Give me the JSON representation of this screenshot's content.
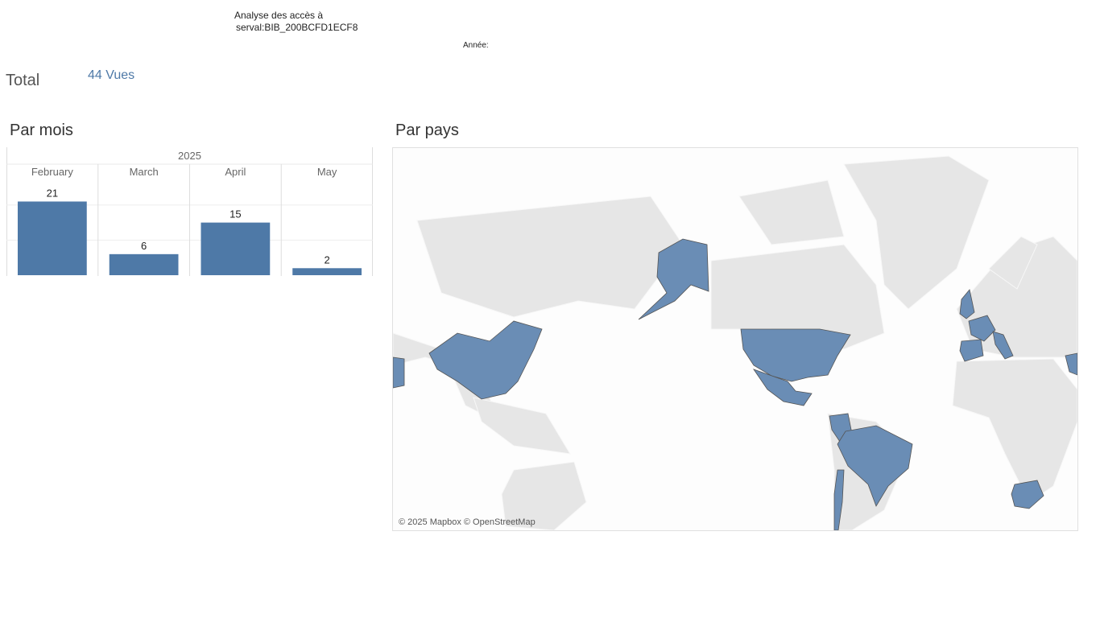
{
  "header": {
    "title_line1": "Analyse des accès à",
    "title_line2": "serval:BIB_200BCFD1ECF8",
    "year_filter_label": "Année:"
  },
  "summary": {
    "total_label": "Total",
    "total_value": "44 Vues"
  },
  "sections": {
    "by_month": "Par mois",
    "by_country": "Par pays"
  },
  "chart_data": {
    "type": "bar",
    "group": "2025",
    "categories": [
      "February",
      "March",
      "April",
      "May"
    ],
    "values": [
      21,
      6,
      15,
      2
    ],
    "ylim": [
      0,
      25
    ],
    "grid": true,
    "bar_color": "#4e79a7"
  },
  "map": {
    "credit": "© 2025 Mapbox © OpenStreetMap",
    "highlight_color": "#6a8db5",
    "land_color": "#e6e6e6"
  }
}
